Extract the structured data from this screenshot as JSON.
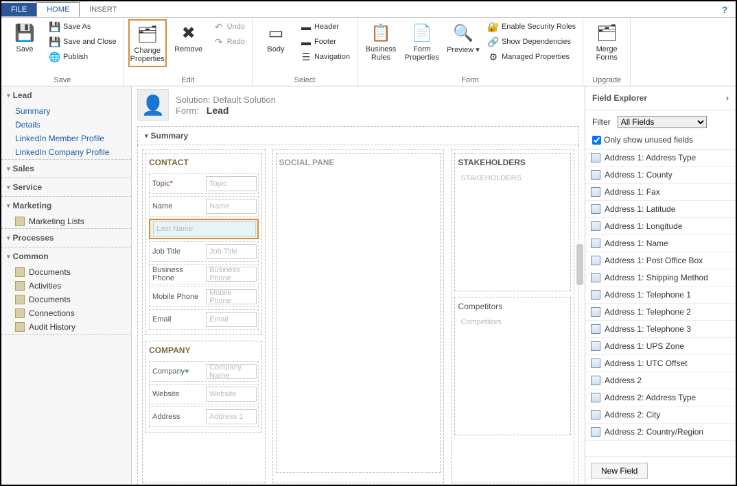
{
  "tabs": {
    "file": "FILE",
    "home": "HOME",
    "insert": "INSERT"
  },
  "ribbon": {
    "save": {
      "label": "Save",
      "saveas": "Save As",
      "saveclose": "Save and Close",
      "publish": "Publish",
      "group": "Save"
    },
    "edit": {
      "change": "Change Properties",
      "remove": "Remove",
      "undo": "Undo",
      "redo": "Redo",
      "group": "Edit"
    },
    "select": {
      "body": "Body",
      "header": "Header",
      "footer": "Footer",
      "nav": "Navigation",
      "group": "Select"
    },
    "form": {
      "rules": "Business Rules",
      "props": "Form Properties",
      "preview": "Preview",
      "security": "Enable Security Roles",
      "deps": "Show Dependencies",
      "managed": "Managed Properties",
      "group": "Form"
    },
    "upgrade": {
      "merge": "Merge Forms",
      "group": "Upgrade"
    }
  },
  "leftnav": {
    "lead": {
      "title": "Lead",
      "items": [
        "Summary",
        "Details",
        "LinkedIn Member Profile",
        "LinkedIn Company Profile"
      ]
    },
    "sales": {
      "title": "Sales"
    },
    "service": {
      "title": "Service"
    },
    "marketing": {
      "title": "Marketing",
      "items": [
        "Marketing Lists"
      ]
    },
    "processes": {
      "title": "Processes"
    },
    "common": {
      "title": "Common",
      "items": [
        "Documents",
        "Activities",
        "Documents",
        "Connections",
        "Audit History"
      ]
    }
  },
  "formHeader": {
    "solution": "Solution: Default Solution",
    "formLabel": "Form:",
    "formName": "Lead"
  },
  "summary": {
    "tab": "Summary",
    "contact": {
      "title": "CONTACT",
      "topic": {
        "label": "Topic",
        "ph": "Topic"
      },
      "name": {
        "label": "Name",
        "ph": "Name"
      },
      "lastname": {
        "ph": "Last Name"
      },
      "jobtitle": {
        "label": "Job Title",
        "ph": "Job Title"
      },
      "bphone": {
        "label": "Business Phone",
        "ph": "Business Phone"
      },
      "mphone": {
        "label": "Mobile Phone",
        "ph": "Mobile Phone"
      },
      "email": {
        "label": "Email",
        "ph": "Email"
      }
    },
    "company": {
      "title": "COMPANY",
      "company": {
        "label": "Company",
        "ph": "Company Name"
      },
      "website": {
        "label": "Website",
        "ph": "Website"
      },
      "address": {
        "label": "Address",
        "ph": "Address 1"
      }
    },
    "social": {
      "title": "SOCIAL PANE"
    },
    "stakeholders": {
      "title": "STAKEHOLDERS",
      "ph": "STAKEHOLDERS"
    },
    "competitors": {
      "title": "Competitors",
      "ph": "Competitors"
    }
  },
  "explorer": {
    "title": "Field Explorer",
    "filterLabel": "Filter",
    "filterValue": "All Fields",
    "onlyUnused": "Only show unused fields",
    "newField": "New Field",
    "fields": [
      "Address 1: Address Type",
      "Address 1: County",
      "Address 1: Fax",
      "Address 1: Latitude",
      "Address 1: Longitude",
      "Address 1: Name",
      "Address 1: Post Office Box",
      "Address 1: Shipping Method",
      "Address 1: Telephone 1",
      "Address 1: Telephone 2",
      "Address 1: Telephone 3",
      "Address 1: UPS Zone",
      "Address 1: UTC Offset",
      "Address 2",
      "Address 2: Address Type",
      "Address 2: City",
      "Address 2: Country/Region"
    ]
  }
}
